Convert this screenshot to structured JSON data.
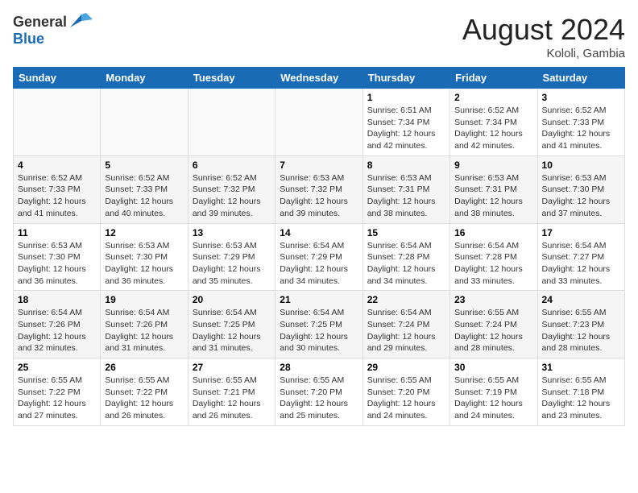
{
  "header": {
    "logo_general": "General",
    "logo_blue": "Blue",
    "month_year": "August 2024",
    "location": "Kololi, Gambia"
  },
  "days_of_week": [
    "Sunday",
    "Monday",
    "Tuesday",
    "Wednesday",
    "Thursday",
    "Friday",
    "Saturday"
  ],
  "weeks": [
    [
      {
        "day": "",
        "info": ""
      },
      {
        "day": "",
        "info": ""
      },
      {
        "day": "",
        "info": ""
      },
      {
        "day": "",
        "info": ""
      },
      {
        "day": "1",
        "info": "Sunrise: 6:51 AM\nSunset: 7:34 PM\nDaylight: 12 hours and 42 minutes."
      },
      {
        "day": "2",
        "info": "Sunrise: 6:52 AM\nSunset: 7:34 PM\nDaylight: 12 hours and 42 minutes."
      },
      {
        "day": "3",
        "info": "Sunrise: 6:52 AM\nSunset: 7:33 PM\nDaylight: 12 hours and 41 minutes."
      }
    ],
    [
      {
        "day": "4",
        "info": "Sunrise: 6:52 AM\nSunset: 7:33 PM\nDaylight: 12 hours and 41 minutes."
      },
      {
        "day": "5",
        "info": "Sunrise: 6:52 AM\nSunset: 7:33 PM\nDaylight: 12 hours and 40 minutes."
      },
      {
        "day": "6",
        "info": "Sunrise: 6:52 AM\nSunset: 7:32 PM\nDaylight: 12 hours and 39 minutes."
      },
      {
        "day": "7",
        "info": "Sunrise: 6:53 AM\nSunset: 7:32 PM\nDaylight: 12 hours and 39 minutes."
      },
      {
        "day": "8",
        "info": "Sunrise: 6:53 AM\nSunset: 7:31 PM\nDaylight: 12 hours and 38 minutes."
      },
      {
        "day": "9",
        "info": "Sunrise: 6:53 AM\nSunset: 7:31 PM\nDaylight: 12 hours and 38 minutes."
      },
      {
        "day": "10",
        "info": "Sunrise: 6:53 AM\nSunset: 7:30 PM\nDaylight: 12 hours and 37 minutes."
      }
    ],
    [
      {
        "day": "11",
        "info": "Sunrise: 6:53 AM\nSunset: 7:30 PM\nDaylight: 12 hours and 36 minutes."
      },
      {
        "day": "12",
        "info": "Sunrise: 6:53 AM\nSunset: 7:30 PM\nDaylight: 12 hours and 36 minutes."
      },
      {
        "day": "13",
        "info": "Sunrise: 6:53 AM\nSunset: 7:29 PM\nDaylight: 12 hours and 35 minutes."
      },
      {
        "day": "14",
        "info": "Sunrise: 6:54 AM\nSunset: 7:29 PM\nDaylight: 12 hours and 34 minutes."
      },
      {
        "day": "15",
        "info": "Sunrise: 6:54 AM\nSunset: 7:28 PM\nDaylight: 12 hours and 34 minutes."
      },
      {
        "day": "16",
        "info": "Sunrise: 6:54 AM\nSunset: 7:28 PM\nDaylight: 12 hours and 33 minutes."
      },
      {
        "day": "17",
        "info": "Sunrise: 6:54 AM\nSunset: 7:27 PM\nDaylight: 12 hours and 33 minutes."
      }
    ],
    [
      {
        "day": "18",
        "info": "Sunrise: 6:54 AM\nSunset: 7:26 PM\nDaylight: 12 hours and 32 minutes."
      },
      {
        "day": "19",
        "info": "Sunrise: 6:54 AM\nSunset: 7:26 PM\nDaylight: 12 hours and 31 minutes."
      },
      {
        "day": "20",
        "info": "Sunrise: 6:54 AM\nSunset: 7:25 PM\nDaylight: 12 hours and 31 minutes."
      },
      {
        "day": "21",
        "info": "Sunrise: 6:54 AM\nSunset: 7:25 PM\nDaylight: 12 hours and 30 minutes."
      },
      {
        "day": "22",
        "info": "Sunrise: 6:54 AM\nSunset: 7:24 PM\nDaylight: 12 hours and 29 minutes."
      },
      {
        "day": "23",
        "info": "Sunrise: 6:55 AM\nSunset: 7:24 PM\nDaylight: 12 hours and 28 minutes."
      },
      {
        "day": "24",
        "info": "Sunrise: 6:55 AM\nSunset: 7:23 PM\nDaylight: 12 hours and 28 minutes."
      }
    ],
    [
      {
        "day": "25",
        "info": "Sunrise: 6:55 AM\nSunset: 7:22 PM\nDaylight: 12 hours and 27 minutes."
      },
      {
        "day": "26",
        "info": "Sunrise: 6:55 AM\nSunset: 7:22 PM\nDaylight: 12 hours and 26 minutes."
      },
      {
        "day": "27",
        "info": "Sunrise: 6:55 AM\nSunset: 7:21 PM\nDaylight: 12 hours and 26 minutes."
      },
      {
        "day": "28",
        "info": "Sunrise: 6:55 AM\nSunset: 7:20 PM\nDaylight: 12 hours and 25 minutes."
      },
      {
        "day": "29",
        "info": "Sunrise: 6:55 AM\nSunset: 7:20 PM\nDaylight: 12 hours and 24 minutes."
      },
      {
        "day": "30",
        "info": "Sunrise: 6:55 AM\nSunset: 7:19 PM\nDaylight: 12 hours and 24 minutes."
      },
      {
        "day": "31",
        "info": "Sunrise: 6:55 AM\nSunset: 7:18 PM\nDaylight: 12 hours and 23 minutes."
      }
    ]
  ]
}
